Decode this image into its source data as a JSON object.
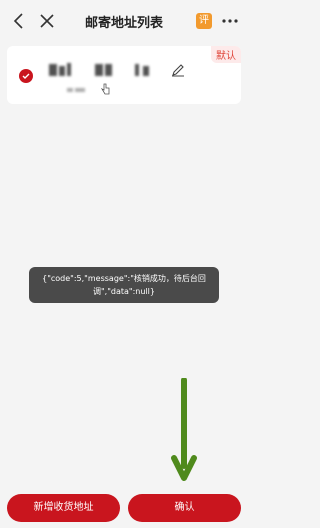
{
  "header": {
    "title": "邮寄地址列表",
    "review_badge": "评"
  },
  "address_card": {
    "default_tag": "默认"
  },
  "toast": {
    "message": "{\"code\":5,\"message\":\"核销成功，待后台回调\",\"data\":null}"
  },
  "buttons": {
    "add_label": "新增收货地址",
    "confirm_label": "确认"
  },
  "colors": {
    "primary_red": "#c9151e",
    "arrow_green": "#4f8a1c",
    "badge_orange": "#f29a2e"
  }
}
